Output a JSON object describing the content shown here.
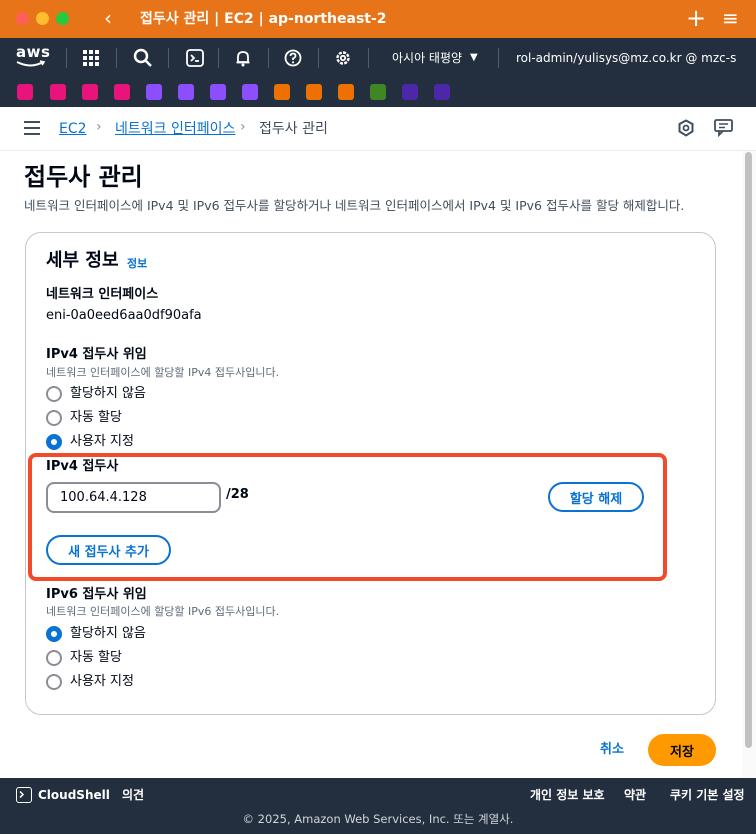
{
  "window": {
    "title": "접두사 관리 | EC2 | ap-northeast-2",
    "back_glyph": "‹",
    "plus_glyph": "+",
    "menu_glyph": "≡"
  },
  "topnav": {
    "logo_text": "aws",
    "region": "아시아 태평양",
    "region_caret": "▼",
    "account": "rol-admin/yulisys@mz.co.kr @ mzc-s",
    "account_caret": "▼",
    "icons": [
      "grid-icon",
      "search-icon",
      "cloudshell-icon",
      "bell-icon",
      "help-icon",
      "gear-icon"
    ]
  },
  "favorites": {
    "colors": [
      "#e7157b",
      "#e7157b",
      "#e7157b",
      "#e7157b",
      "#8c4fff",
      "#8c4fff",
      "#8c4fff",
      "#8c4fff",
      "#ed7100",
      "#ed7100",
      "#ed7100",
      "#3f8624",
      "#4d27aa",
      "#4d27aa"
    ]
  },
  "breadcrumb": {
    "items": [
      {
        "label": "EC2",
        "link": true
      },
      {
        "label": "네트워크 인터페이스",
        "link": true
      },
      {
        "label": "접두사 관리",
        "link": false
      }
    ],
    "separator": "›"
  },
  "page": {
    "title": "접두사 관리",
    "description": "네트워크 인터페이스에 IPv4 및 IPv6 접두사를 할당하거나 네트워크 인터페이스에서 IPv4 및 IPv6 접두사를 할당 해제합니다."
  },
  "panel": {
    "title": "세부 정보",
    "info_link": "정보",
    "eni_label": "네트워크 인터페이스",
    "eni_value": "eni-0a0eed6aa0df90afa",
    "ipv4": {
      "section_label": "IPv4 접두사 위임",
      "hint": "네트워크 인터페이스에 할당할 IPv4 접두사입니다.",
      "options": [
        "할당하지 않음",
        "자동 할당",
        "사용자 지정"
      ],
      "selected_index": 2,
      "prefix_label": "IPv4 접두사",
      "prefix_value": "100.64.4.128",
      "prefix_suffix": "/28",
      "unassign_button": "할당 해제",
      "add_button": "새 접두사 추가"
    },
    "ipv6": {
      "section_label": "IPv6 접두사 위임",
      "hint": "네트워크 인터페이스에 할당할 IPv6 접두사입니다.",
      "options": [
        "할당하지 않음",
        "자동 할당",
        "사용자 지정"
      ],
      "selected_index": 0
    }
  },
  "actions": {
    "cancel": "취소",
    "save": "저장"
  },
  "footer": {
    "cloudshell": "CloudShell",
    "feedback": "의견",
    "privacy": "개인 정보 보호",
    "terms": "약관",
    "cookies": "쿠키 기본 설정",
    "copyright": "© 2025, Amazon Web Services, Inc. 또는 계열사."
  },
  "colors": {
    "titlebar": "#e8741a",
    "nav": "#232f3e",
    "link": "#0972d3",
    "primary": "#ff9900",
    "highlight": "#f24b2c"
  }
}
